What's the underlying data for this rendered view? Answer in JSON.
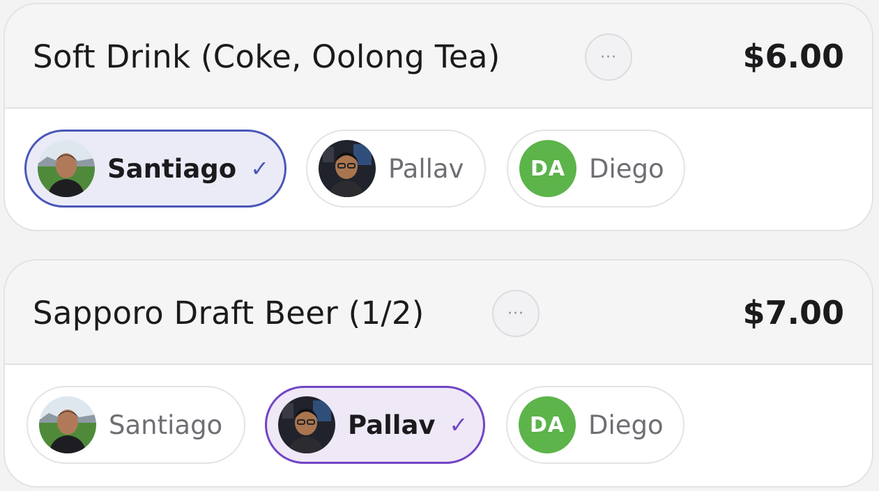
{
  "items": [
    {
      "name": "Soft Drink (Coke, Oolong Tea)",
      "more_label": "···",
      "price": "$6.00",
      "people": [
        {
          "name": "Santiago",
          "selected": true,
          "check": "✓",
          "avatar": "santiago-photo"
        },
        {
          "name": "Pallav",
          "selected": false,
          "avatar": "pallav-photo"
        },
        {
          "name": "Diego",
          "selected": false,
          "initials": "DA"
        }
      ]
    },
    {
      "name": "Sapporo Draft Beer (1/2)",
      "more_label": "···",
      "price": "$7.00",
      "people": [
        {
          "name": "Santiago",
          "selected": false,
          "avatar": "santiago-photo"
        },
        {
          "name": "Pallav",
          "selected": true,
          "check": "✓",
          "avatar": "pallav-photo"
        },
        {
          "name": "Diego",
          "selected": false,
          "initials": "DA"
        }
      ]
    }
  ],
  "colors": {
    "selected_blue": "#4a57b8",
    "selected_purple": "#7145c4",
    "initials_green": "#5cb44a"
  }
}
